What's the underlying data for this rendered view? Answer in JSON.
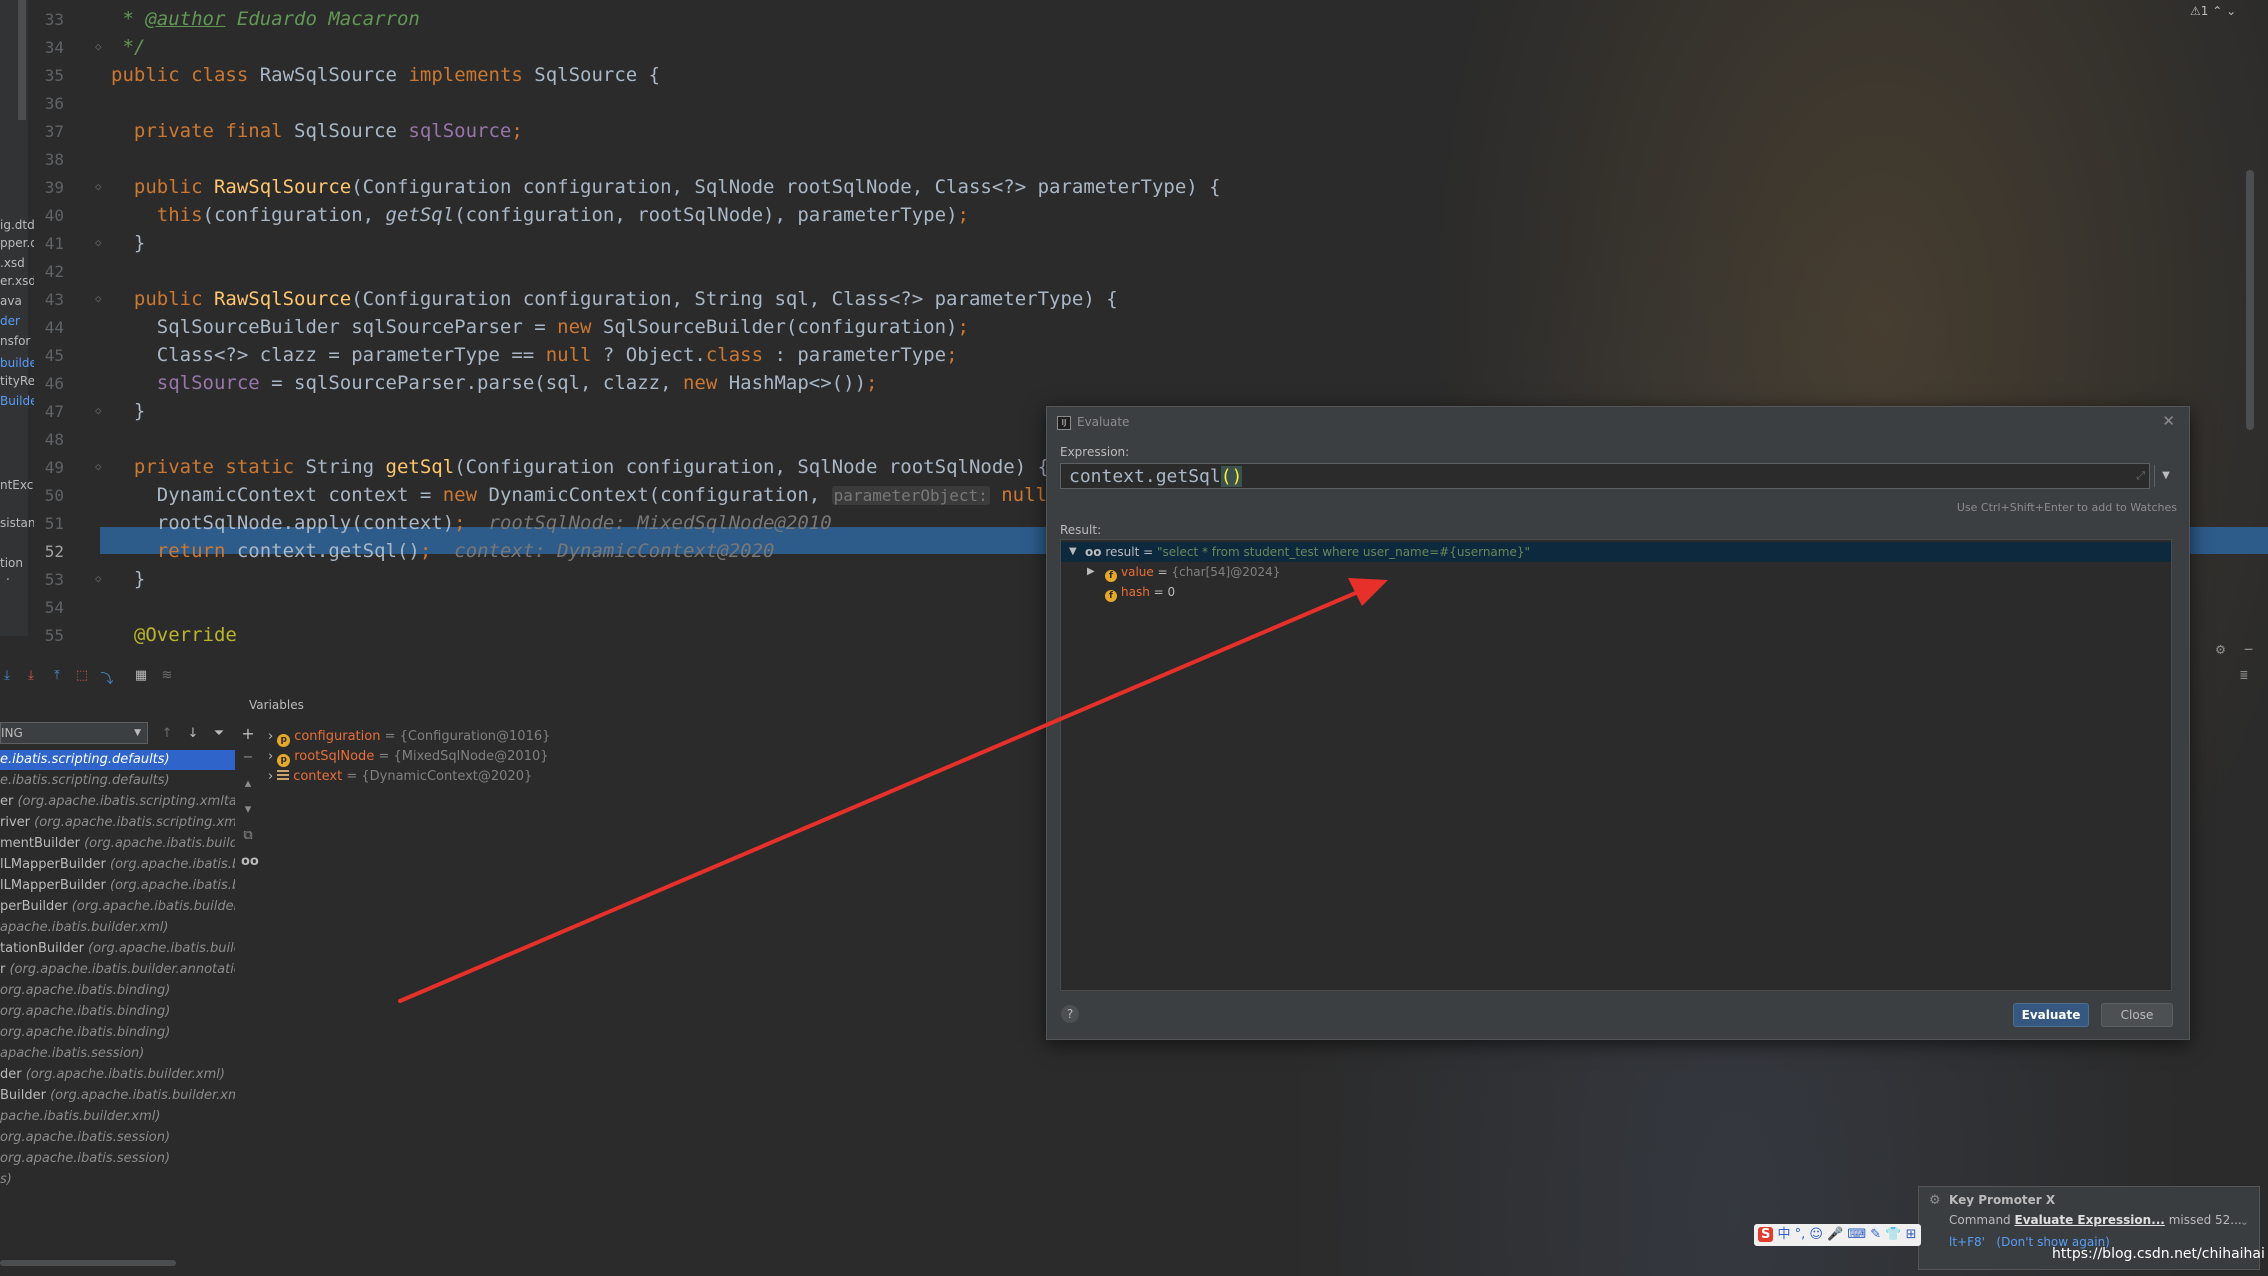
{
  "editor": {
    "lines": [
      {
        "num": "33",
        "fold": "",
        "segments": [
          {
            "t": " * ",
            "c": "doc"
          },
          {
            "t": "@author",
            "c": "docu"
          },
          {
            "t": " Eduardo Macarron",
            "c": "doc"
          }
        ]
      },
      {
        "num": "34",
        "fold": "◇",
        "segments": [
          {
            "t": " */",
            "c": "doc"
          }
        ]
      },
      {
        "num": "35",
        "fold": "",
        "segments": [
          {
            "t": "public class ",
            "c": "kw"
          },
          {
            "t": "RawSqlSource ",
            "c": ""
          },
          {
            "t": "implements ",
            "c": "kw"
          },
          {
            "t": "SqlSource {",
            "c": ""
          }
        ]
      },
      {
        "num": "36",
        "fold": "",
        "segments": []
      },
      {
        "num": "37",
        "fold": "",
        "segments": [
          {
            "t": "  private final ",
            "c": "kw"
          },
          {
            "t": "SqlSource ",
            "c": ""
          },
          {
            "t": "sqlSource",
            "c": "fld"
          },
          {
            "t": ";",
            "c": "kw"
          }
        ]
      },
      {
        "num": "38",
        "fold": "",
        "segments": []
      },
      {
        "num": "39",
        "fold": "◇",
        "segments": [
          {
            "t": "  public ",
            "c": "kw"
          },
          {
            "t": "RawSqlSource",
            "c": "fn"
          },
          {
            "t": "(Configuration configuration, SqlNode rootSqlNode, Class<?> parameterType) {",
            "c": ""
          }
        ]
      },
      {
        "num": "40",
        "fold": "",
        "segments": [
          {
            "t": "    this",
            "c": "kw"
          },
          {
            "t": "(configuration, ",
            "c": ""
          },
          {
            "t": "getSql",
            "c": "it"
          },
          {
            "t": "(configuration, rootSqlNode), parameterType)",
            "c": ""
          },
          {
            "t": ";",
            "c": "kw"
          }
        ]
      },
      {
        "num": "41",
        "fold": "◇",
        "segments": [
          {
            "t": "  }",
            "c": ""
          }
        ]
      },
      {
        "num": "42",
        "fold": "",
        "segments": []
      },
      {
        "num": "43",
        "fold": "◇",
        "segments": [
          {
            "t": "  public ",
            "c": "kw"
          },
          {
            "t": "RawSqlSource",
            "c": "fn"
          },
          {
            "t": "(Configuration configuration, String sql, Class<?> parameterType) {",
            "c": ""
          }
        ]
      },
      {
        "num": "44",
        "fold": "",
        "segments": [
          {
            "t": "    SqlSourceBuilder sqlSourceParser = ",
            "c": ""
          },
          {
            "t": "new ",
            "c": "kw"
          },
          {
            "t": "SqlSourceBuilder(configuration)",
            "c": ""
          },
          {
            "t": ";",
            "c": "kw"
          }
        ]
      },
      {
        "num": "45",
        "fold": "",
        "segments": [
          {
            "t": "    Class<?> clazz = parameterType == ",
            "c": ""
          },
          {
            "t": "null ",
            "c": "kw"
          },
          {
            "t": "? Object.",
            "c": ""
          },
          {
            "t": "class ",
            "c": "kw"
          },
          {
            "t": ": parameterType",
            "c": ""
          },
          {
            "t": ";",
            "c": "kw"
          }
        ]
      },
      {
        "num": "46",
        "fold": "",
        "segments": [
          {
            "t": "    ",
            "c": ""
          },
          {
            "t": "sqlSource",
            "c": "fld"
          },
          {
            "t": " = sqlSourceParser.parse(sql, clazz, ",
            "c": ""
          },
          {
            "t": "new ",
            "c": "kw"
          },
          {
            "t": "HashMap<>())",
            "c": ""
          },
          {
            "t": ";",
            "c": "kw"
          }
        ]
      },
      {
        "num": "47",
        "fold": "◇",
        "segments": [
          {
            "t": "  }",
            "c": ""
          }
        ]
      },
      {
        "num": "48",
        "fold": "",
        "segments": []
      },
      {
        "num": "49",
        "fold": "◇",
        "segments": [
          {
            "t": "  private static ",
            "c": "kw"
          },
          {
            "t": "String ",
            "c": ""
          },
          {
            "t": "getSql",
            "c": "fn"
          },
          {
            "t": "(Configuration configuration, SqlNode rootSqlNode) {  ",
            "c": ""
          },
          {
            "t": "c",
            "c": "hint"
          }
        ]
      },
      {
        "num": "50",
        "fold": "",
        "segments": [
          {
            "t": "    DynamicContext context = ",
            "c": ""
          },
          {
            "t": "new ",
            "c": "kw"
          },
          {
            "t": "DynamicContext(configuration, ",
            "c": ""
          },
          {
            "t": "parameterObject:",
            "c": "phint"
          },
          {
            "t": " null",
            "c": "kw"
          },
          {
            "t": ");",
            "c": "kw"
          }
        ]
      },
      {
        "num": "51",
        "fold": "",
        "segments": [
          {
            "t": "    rootSqlNode.apply(context)",
            "c": ""
          },
          {
            "t": ";",
            "c": "kw"
          },
          {
            "t": "  rootSqlNode: MixedSqlNode@2010",
            "c": "hint"
          }
        ]
      },
      {
        "num": "52",
        "fold": "",
        "segments": [
          {
            "t": "    return ",
            "c": "kw"
          },
          {
            "t": "context.getSql()",
            "c": ""
          },
          {
            "t": ";",
            "c": "kw"
          },
          {
            "t": "  context: DynamicContext@2020",
            "c": "hint"
          }
        ]
      },
      {
        "num": "53",
        "fold": "◇",
        "segments": [
          {
            "t": "  }",
            "c": ""
          }
        ]
      },
      {
        "num": "54",
        "fold": "",
        "segments": []
      },
      {
        "num": "55",
        "fold": "",
        "segments": [
          {
            "t": "  @Override",
            "c": "ann"
          }
        ]
      }
    ],
    "warning": "⚠1 ⌃ ⌄",
    "project_items": [
      "ig.dtd",
      "pper.d",
      ".xsd",
      "er.xsd",
      "ava",
      "der",
      "nsfor",
      "builder",
      "tityRe",
      "Builde",
      "ntExce",
      "sistan",
      "tion",
      "st"
    ]
  },
  "debugger": {
    "thread_select": "ING",
    "variables_label": "Variables",
    "frames": [
      {
        "name": "",
        "pkg": "e.ibatis.scripting.defaults)",
        "selected": true
      },
      {
        "name": "",
        "pkg": "e.ibatis.scripting.defaults)",
        "selected": false
      },
      {
        "name": "er ",
        "pkg": "(org.apache.ibatis.scripting.xmltags)",
        "selected": false
      },
      {
        "name": "river ",
        "pkg": "(org.apache.ibatis.scripting.xmltags",
        "selected": false
      },
      {
        "name": "mentBuilder ",
        "pkg": "(org.apache.ibatis.builder.x",
        "selected": false
      },
      {
        "name": "lLMapperBuilder ",
        "pkg": "(org.apache.ibatis.build",
        "selected": false
      },
      {
        "name": "lLMapperBuilder ",
        "pkg": "(org.apache.ibatis.build",
        "selected": false
      },
      {
        "name": "perBuilder ",
        "pkg": "(org.apache.ibatis.builder.xml)",
        "selected": false
      },
      {
        "name": "",
        "pkg": "apache.ibatis.builder.xml)",
        "selected": false
      },
      {
        "name": "tationBuilder ",
        "pkg": "(org.apache.ibatis.builder.a",
        "selected": false
      },
      {
        "name": "r ",
        "pkg": "(org.apache.ibatis.builder.annotation)",
        "selected": false
      },
      {
        "name": "",
        "pkg": "org.apache.ibatis.binding)",
        "selected": false
      },
      {
        "name": "",
        "pkg": "org.apache.ibatis.binding)",
        "selected": false
      },
      {
        "name": "",
        "pkg": "org.apache.ibatis.binding)",
        "selected": false
      },
      {
        "name": "",
        "pkg": "apache.ibatis.session)",
        "selected": false
      },
      {
        "name": "der ",
        "pkg": "(org.apache.ibatis.builder.xml)",
        "selected": false
      },
      {
        "name": "Builder ",
        "pkg": "(org.apache.ibatis.builder.xml)",
        "selected": false
      },
      {
        "name": "",
        "pkg": "pache.ibatis.builder.xml)",
        "selected": false
      },
      {
        "name": "",
        "pkg": "org.apache.ibatis.session)",
        "selected": false
      },
      {
        "name": "",
        "pkg": "org.apache.ibatis.session)",
        "selected": false
      },
      {
        "name": "",
        "pkg": "s)",
        "selected": false
      }
    ],
    "variables": [
      {
        "name": "configuration",
        "value": " = {Configuration@1016}",
        "badge": "p"
      },
      {
        "name": "rootSqlNode",
        "value": " = {MixedSqlNode@2010}",
        "badge": "p"
      },
      {
        "name": "context",
        "value": " = {DynamicContext@2020}",
        "badge": "list"
      }
    ]
  },
  "evaluate_dialog": {
    "title": "Evaluate",
    "expression_label": "Expression:",
    "expression_prefix": "context.getSql",
    "expression_parens": "()",
    "hint": "Use Ctrl+Shift+Enter to add to Watches",
    "result_label": "Result:",
    "result_rows": [
      {
        "name": "result",
        "eq": " = ",
        "value": "\"select * from student_test where user_name=#{username}\"",
        "kind": "string"
      },
      {
        "name": "value",
        "eq": " = ",
        "value": "{char[54]@2024}",
        "kind": "obj"
      },
      {
        "name": "hash",
        "eq": " = ",
        "value": "0",
        "kind": "num"
      }
    ],
    "evaluate_button": "Evaluate",
    "close_button": "Close",
    "help": "?"
  },
  "key_promoter": {
    "title": "Key Promoter X",
    "msg_prefix": "Command ",
    "msg_link": "Evaluate Expression...",
    "msg_suffix": " missed 52...",
    "shortcut": "lt+F8'",
    "dont_show": "(Don't show again)"
  },
  "ime": {
    "s": "S",
    "rest": " 中 °, ☺ 🎤 ⌨ ✎ 👕 ⊞"
  },
  "watermark": "https://blog.csdn.net/chihaihai",
  "colors": {
    "arrow": "#e8302a",
    "selection": "#2d5b8a",
    "accent": "#365880"
  }
}
